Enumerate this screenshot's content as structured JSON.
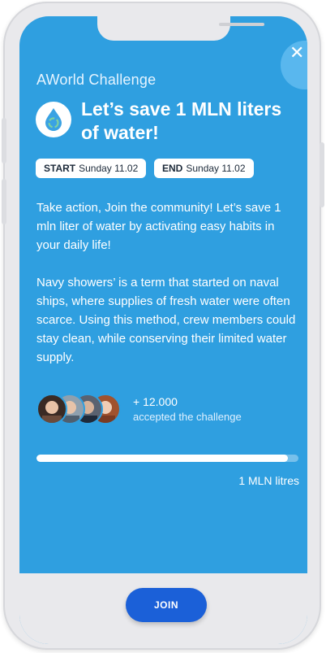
{
  "app": {
    "brand": "AWorld Challenge"
  },
  "challenge": {
    "title": "Let’s save 1 MLN liters of water!",
    "start": {
      "label": "START",
      "value": "Sunday 11.02"
    },
    "end": {
      "label": "END",
      "value": "Sunday 11.02"
    },
    "description": [
      "Take action, Join the community! Let’s save 1 mln liter of water by activating easy habits in your daily life!",
      "Navy showers’ is a term that started on naval ships, where supplies of fresh water were often scarce. Using this method, crew members could stay clean, while conserving their limited water supply."
    ]
  },
  "participants": {
    "count": "+ 12.000",
    "caption": "accepted the challenge",
    "avatars": [
      "avatar-1",
      "avatar-2",
      "avatar-3",
      "avatar-4"
    ]
  },
  "progress": {
    "fraction": 0.96,
    "goal_label": "1 MLN litres"
  },
  "actions": {
    "join_label": "JOIN",
    "close_icon": "close-icon"
  },
  "colors": {
    "background": "#2f9fe0",
    "button": "#1b60d8"
  }
}
